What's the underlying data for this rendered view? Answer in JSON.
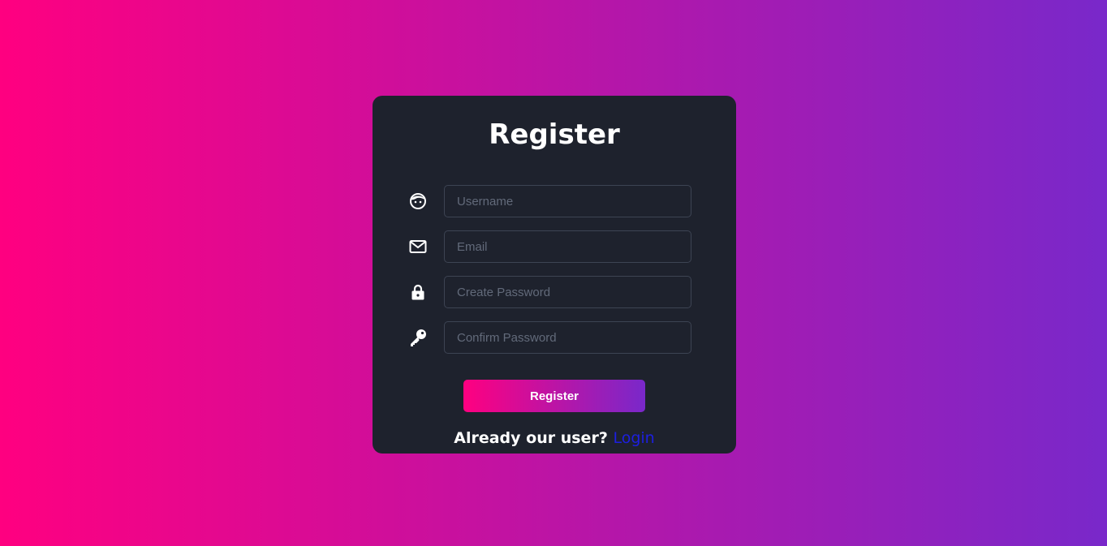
{
  "form": {
    "title": "Register",
    "fields": [
      {
        "icon": "face-icon",
        "placeholder": "Username",
        "value": ""
      },
      {
        "icon": "envelope-icon",
        "placeholder": "Email",
        "value": ""
      },
      {
        "icon": "lock-icon",
        "placeholder": "Create Password",
        "value": ""
      },
      {
        "icon": "key-icon",
        "placeholder": "Confirm Password",
        "value": ""
      }
    ],
    "submit_label": "Register",
    "footer_text": "Already our user?",
    "login_link": "Login"
  },
  "colors": {
    "gradient_start": "#ff0080",
    "gradient_end": "#7928ca",
    "card_bg": "#1e222d",
    "link": "#1d1fe0"
  }
}
